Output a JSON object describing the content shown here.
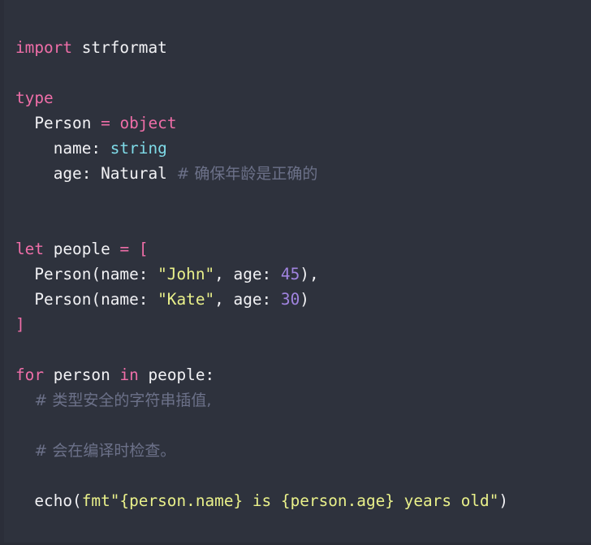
{
  "editor": {
    "language": "nim",
    "background_color": "#2e323d",
    "gutter_color": "#2b2e39",
    "font_size_px": 19.4,
    "line_height_px": 31
  },
  "theme": {
    "keyword": "#ef6ea8",
    "plain": "#f2f2f5",
    "builtin_type": "#7fdbe8",
    "string": "#e9f08a",
    "number": "#a184e0",
    "comment": "#6c7189",
    "bracket": "#ef6ea8"
  },
  "code": {
    "lines": [
      {
        "n": 1,
        "tokens": [
          {
            "t": "import",
            "k": "keyword"
          },
          {
            "t": " strformat",
            "k": "plain"
          }
        ]
      },
      {
        "n": 2,
        "tokens": []
      },
      {
        "n": 3,
        "tokens": [
          {
            "t": "type",
            "k": "keyword"
          }
        ]
      },
      {
        "n": 4,
        "tokens": [
          {
            "t": "  Person ",
            "k": "plain"
          },
          {
            "t": "=",
            "k": "keyword"
          },
          {
            "t": " ",
            "k": "plain"
          },
          {
            "t": "object",
            "k": "keyword"
          }
        ]
      },
      {
        "n": 5,
        "tokens": [
          {
            "t": "    name: ",
            "k": "plain"
          },
          {
            "t": "string",
            "k": "builtin"
          }
        ]
      },
      {
        "n": 6,
        "tokens": [
          {
            "t": "    age: Natural ",
            "k": "plain"
          },
          {
            "t": "# 确保年龄是正确的",
            "k": "comment"
          }
        ]
      },
      {
        "n": 7,
        "tokens": []
      },
      {
        "n": 8,
        "tokens": []
      },
      {
        "n": 9,
        "tokens": [
          {
            "t": "let",
            "k": "keyword"
          },
          {
            "t": " people ",
            "k": "plain"
          },
          {
            "t": "=",
            "k": "keyword"
          },
          {
            "t": " ",
            "k": "plain"
          },
          {
            "t": "[",
            "k": "bracket"
          }
        ]
      },
      {
        "n": 10,
        "tokens": [
          {
            "t": "  Person(name: ",
            "k": "plain"
          },
          {
            "t": "\"John\"",
            "k": "string"
          },
          {
            "t": ", age: ",
            "k": "plain"
          },
          {
            "t": "45",
            "k": "number"
          },
          {
            "t": "),",
            "k": "plain"
          }
        ]
      },
      {
        "n": 11,
        "tokens": [
          {
            "t": "  Person(name: ",
            "k": "plain"
          },
          {
            "t": "\"Kate\"",
            "k": "string"
          },
          {
            "t": ", age: ",
            "k": "plain"
          },
          {
            "t": "30",
            "k": "number"
          },
          {
            "t": ")",
            "k": "plain"
          }
        ]
      },
      {
        "n": 12,
        "tokens": [
          {
            "t": "]",
            "k": "bracket"
          }
        ]
      },
      {
        "n": 13,
        "tokens": []
      },
      {
        "n": 14,
        "tokens": [
          {
            "t": "for",
            "k": "keyword"
          },
          {
            "t": " person ",
            "k": "plain"
          },
          {
            "t": "in",
            "k": "keyword"
          },
          {
            "t": " people:",
            "k": "plain"
          }
        ]
      },
      {
        "n": 15,
        "tokens": [
          {
            "t": "  ",
            "k": "plain"
          },
          {
            "t": "# 类型安全的字符串插值,",
            "k": "comment"
          }
        ]
      },
      {
        "n": 16,
        "tokens": []
      },
      {
        "n": 17,
        "tokens": [
          {
            "t": "  ",
            "k": "plain"
          },
          {
            "t": "# 会在编译时检查。",
            "k": "comment"
          }
        ]
      },
      {
        "n": 18,
        "tokens": []
      },
      {
        "n": 19,
        "tokens": [
          {
            "t": "  echo(",
            "k": "plain"
          },
          {
            "t": "fmt\"{person.name} is {person.age} years old\"",
            "k": "string"
          },
          {
            "t": ")",
            "k": "plain"
          }
        ]
      }
    ]
  }
}
